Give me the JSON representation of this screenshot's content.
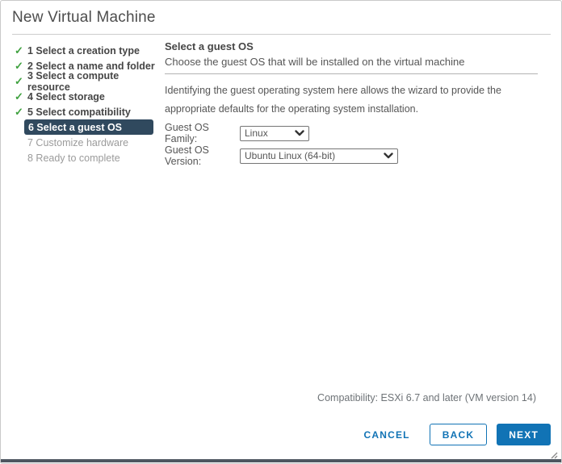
{
  "colors": {
    "accent_blue": "#1173B5",
    "active_step_bg": "#30495E",
    "check_green": "#3FA13F"
  },
  "icons": {
    "check_glyph": "✓"
  },
  "dialog": {
    "title": "New Virtual Machine"
  },
  "steps": [
    {
      "label": "1 Select a creation type",
      "state": "completed"
    },
    {
      "label": "2 Select a name and folder",
      "state": "completed"
    },
    {
      "label": "3 Select a compute resource",
      "state": "completed"
    },
    {
      "label": "4 Select storage",
      "state": "completed"
    },
    {
      "label": "5 Select compatibility",
      "state": "completed"
    },
    {
      "label": "6 Select a guest OS",
      "state": "active"
    },
    {
      "label": "7 Customize hardware",
      "state": "upcoming"
    },
    {
      "label": "8 Ready to complete",
      "state": "upcoming"
    }
  ],
  "content": {
    "heading": "Select a guest OS",
    "subheading": "Choose the guest OS that will be installed on the virtual machine",
    "description": "Identifying the guest operating system here allows the wizard to provide the appropriate defaults for the operating system installation.",
    "fields": {
      "family": {
        "label": "Guest OS Family:",
        "value": "Linux"
      },
      "version": {
        "label": "Guest OS Version:",
        "value": "Ubuntu Linux (64-bit)"
      }
    }
  },
  "footer": {
    "compatibility": "Compatibility: ESXi 6.7 and later (VM version 14)",
    "cancel_label": "CANCEL",
    "back_label": "BACK",
    "next_label": "NEXT"
  }
}
